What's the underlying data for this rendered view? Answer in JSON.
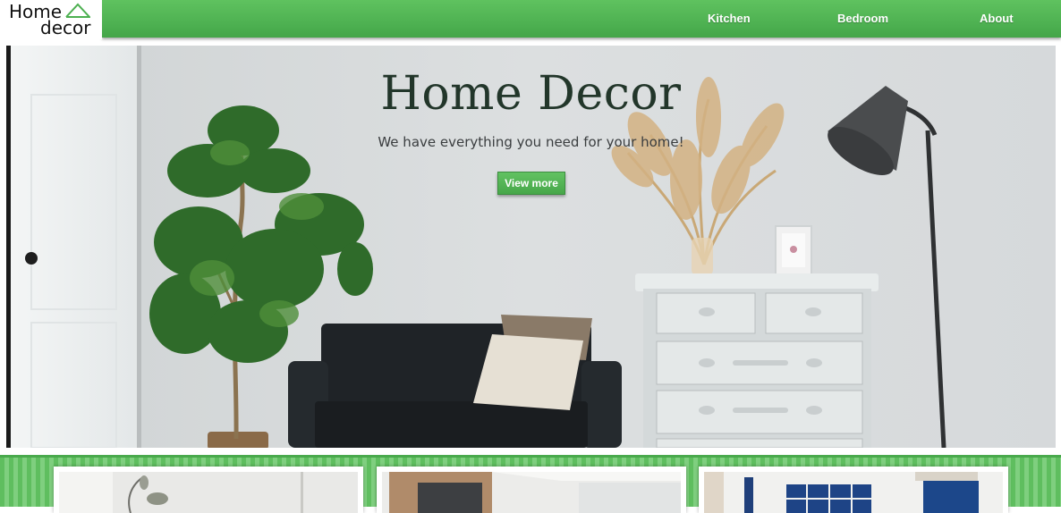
{
  "logo": {
    "line1": "Home",
    "line2": "decor"
  },
  "nav": {
    "items": [
      "Kitchen",
      "Bedroom",
      "About"
    ]
  },
  "hero": {
    "title": "Home Decor",
    "subtitle": "We have everything you need for your home!",
    "button_label": "View more"
  },
  "colors": {
    "brand_green": "#4caf50",
    "title_green": "#22362a"
  }
}
